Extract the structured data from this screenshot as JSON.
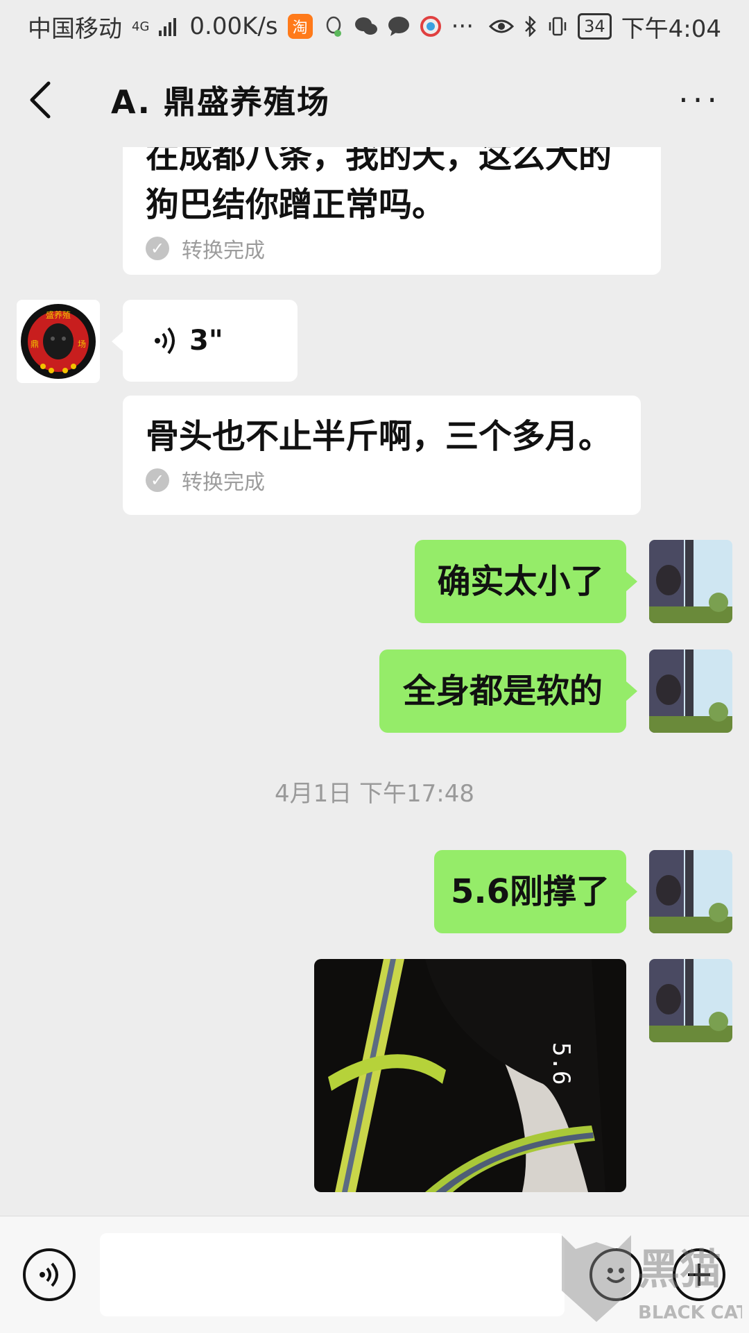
{
  "status_bar": {
    "carrier": "中国移动",
    "network": "4G",
    "speed": "0.00K/s",
    "app_icons": [
      "taobao-icon",
      "qq-icon",
      "wechat-icon",
      "message-icon",
      "browser-icon"
    ],
    "more": "···",
    "battery": "34",
    "time": "下午4:04"
  },
  "header": {
    "title": "A. 鼎盛养殖场",
    "more_label": "···"
  },
  "messages": {
    "m1": {
      "text_partial": "在成都八条，我的天，这么大的",
      "text": "狗巴结你蹭正常吗。",
      "status": "转换完成"
    },
    "m2": {
      "voice_duration": "3\""
    },
    "m3": {
      "text": "骨头也不止半斤啊，三个多月。",
      "status": "转换完成"
    },
    "m4": {
      "text": "确实太小了"
    },
    "m5": {
      "text": "全身都是软的"
    },
    "timestamp": "4月1日 下午17:48",
    "m6": {
      "text": "5.6刚撑了"
    },
    "m7": {
      "image_display": "5.6"
    }
  },
  "contact_avatar": {
    "text_top": "盛养殖",
    "text_left": "鼎",
    "text_right": "场"
  },
  "input_bar": {
    "placeholder": ""
  },
  "watermark": {
    "text": "黑猫",
    "sub": "BLACK CAT"
  },
  "colors": {
    "background": "#ededed",
    "own_bubble": "#95ec69",
    "other_bubble": "#ffffff"
  }
}
